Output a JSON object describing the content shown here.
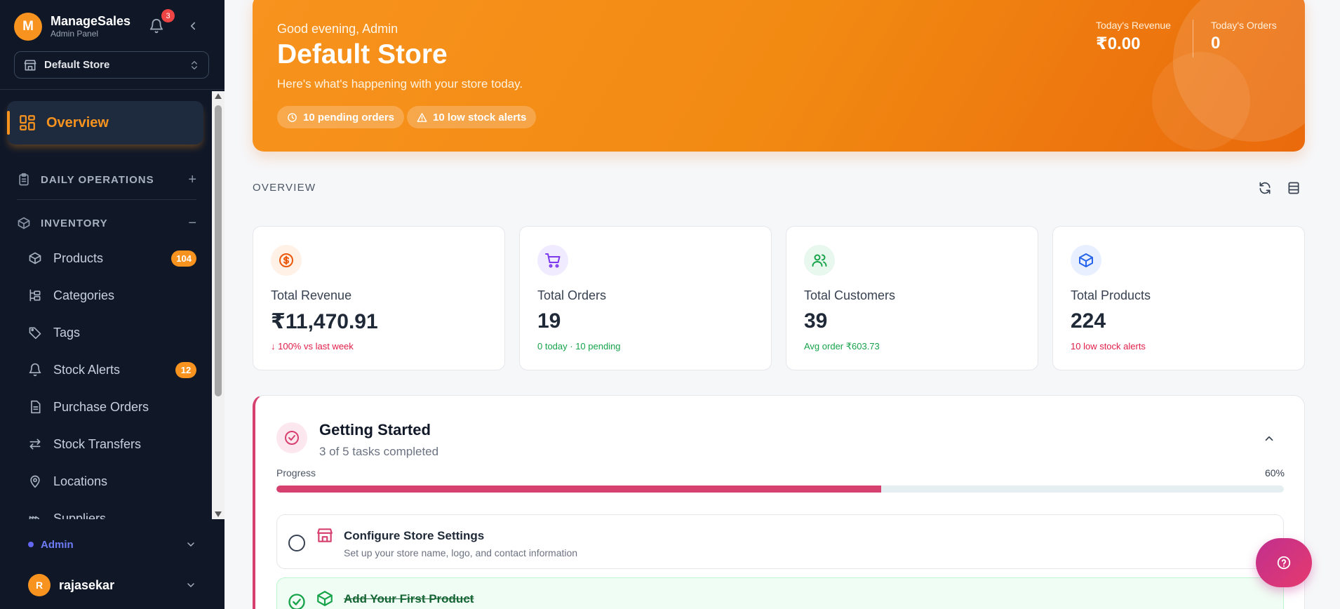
{
  "brand": {
    "logo_letter": "M",
    "name": "ManageSales",
    "subtitle": "Admin Panel"
  },
  "notifications": {
    "count": "3"
  },
  "store_selector": {
    "value": "Default Store"
  },
  "nav": {
    "active": "Overview",
    "sections": [
      {
        "label": "DAILY OPERATIONS",
        "state": "+"
      },
      {
        "label": "INVENTORY",
        "state": "−"
      }
    ],
    "items": [
      {
        "label": "Products",
        "badge": "104"
      },
      {
        "label": "Categories",
        "badge": ""
      },
      {
        "label": "Tags",
        "badge": ""
      },
      {
        "label": "Stock Alerts",
        "badge": "12"
      },
      {
        "label": "Purchase Orders",
        "badge": ""
      },
      {
        "label": "Stock Transfers",
        "badge": ""
      },
      {
        "label": "Locations",
        "badge": ""
      },
      {
        "label": "Suppliers",
        "badge": ""
      }
    ]
  },
  "role": {
    "label": "Admin"
  },
  "user": {
    "initial": "R",
    "name": "rajasekar"
  },
  "hero": {
    "greeting": "Good evening, Admin",
    "store_name": "Default Store",
    "subtitle": "Here's what's happening with your store today.",
    "pending_pill": "10 pending orders",
    "lowstock_pill": "10 low stock alerts",
    "revenue_label": "Today's Revenue",
    "revenue_value": "₹0.00",
    "orders_label": "Today's Orders",
    "orders_value": "0"
  },
  "overview": {
    "label": "OVERVIEW"
  },
  "cards": [
    {
      "title": "Total Revenue",
      "value": "₹11,470.91",
      "note": "↓ 100% vs last week",
      "note_color": "#e11d48",
      "icon": "dollar-icon",
      "icon_color": "#ea580c",
      "icon_bg": "#fff1e6"
    },
    {
      "title": "Total Orders",
      "value": "19",
      "note": "0 today · 10 pending",
      "note_color": "#16a34a",
      "icon": "cart-icon",
      "icon_color": "#7c3aed",
      "icon_bg": "#f1ebff"
    },
    {
      "title": "Total Customers",
      "value": "39",
      "note": "Avg order ₹603.73",
      "note_color": "#16a34a",
      "icon": "users-icon",
      "icon_color": "#16a34a",
      "icon_bg": "#e8f8ee"
    },
    {
      "title": "Total Products",
      "value": "224",
      "note": "10 low stock alerts",
      "note_color": "#e11d48",
      "icon": "box-icon",
      "icon_color": "#2563eb",
      "icon_bg": "#e8f0ff"
    }
  ],
  "getting_started": {
    "title": "Getting Started",
    "subtitle": "3 of 5 tasks completed",
    "progress_label": "Progress",
    "progress_text": "60%",
    "progress": 60,
    "tasks": [
      {
        "title": "Configure Store Settings",
        "desc": "Set up your store name, logo, and contact information",
        "done": false
      },
      {
        "title": "Add Your First Product",
        "desc": "",
        "done": true
      }
    ]
  },
  "colors": {
    "brand": "#f7931e",
    "sidebar": "#101828",
    "accent_pink": "#d6416f"
  }
}
